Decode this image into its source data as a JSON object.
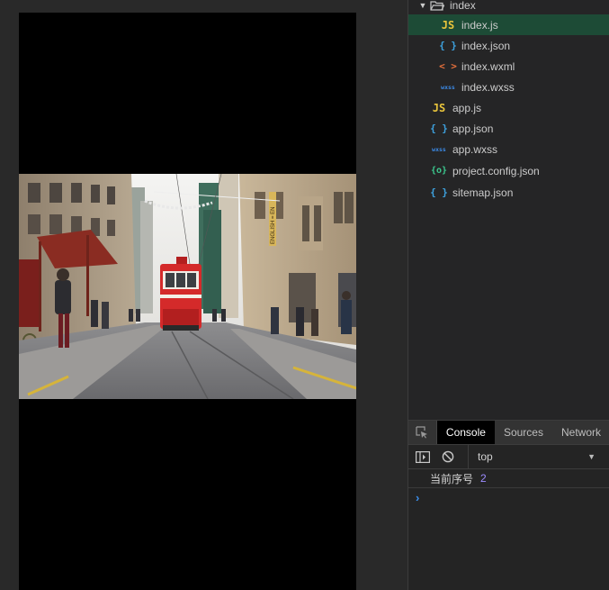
{
  "file_tree": {
    "folder": {
      "name": "index",
      "icon": "folder-open-icon",
      "expanded": true
    },
    "folder_children": [
      {
        "icon_text": "JS",
        "type": "js",
        "name": "index.js",
        "selected": true
      },
      {
        "icon_text": "{ }",
        "type": "json",
        "name": "index.json",
        "selected": false
      },
      {
        "icon_text": "< >",
        "type": "wxml",
        "name": "index.wxml",
        "selected": false
      },
      {
        "icon_text": "wxss",
        "type": "wxss",
        "name": "index.wxss",
        "selected": false
      }
    ],
    "root_files": [
      {
        "icon_text": "JS",
        "type": "js",
        "name": "app.js"
      },
      {
        "icon_text": "{ }",
        "type": "json",
        "name": "app.json"
      },
      {
        "icon_text": "wxss",
        "type": "wxss",
        "name": "app.wxss"
      },
      {
        "icon_text": "{o}",
        "type": "config",
        "name": "project.config.json"
      },
      {
        "icon_text": "{ }",
        "type": "json",
        "name": "sitemap.json"
      }
    ]
  },
  "devtools": {
    "tabs": [
      "Console",
      "Sources",
      "Network"
    ],
    "active_tab": "Console",
    "context": "top",
    "log": {
      "label": "当前序号",
      "value": "2"
    },
    "prompt": "›"
  },
  "simulator": {
    "image": {
      "icon": "street-tram-photo",
      "sign_text": "ENGLISH = EN"
    }
  },
  "colors": {
    "selected_row": "#1d4b36",
    "js": "#e8c43c",
    "json": "#3ea3e0",
    "wxml": "#e8713c",
    "wxss": "#3c8be8",
    "config": "#3cc88e",
    "log_number": "#9d8cff",
    "prompt": "#3b8eea"
  }
}
